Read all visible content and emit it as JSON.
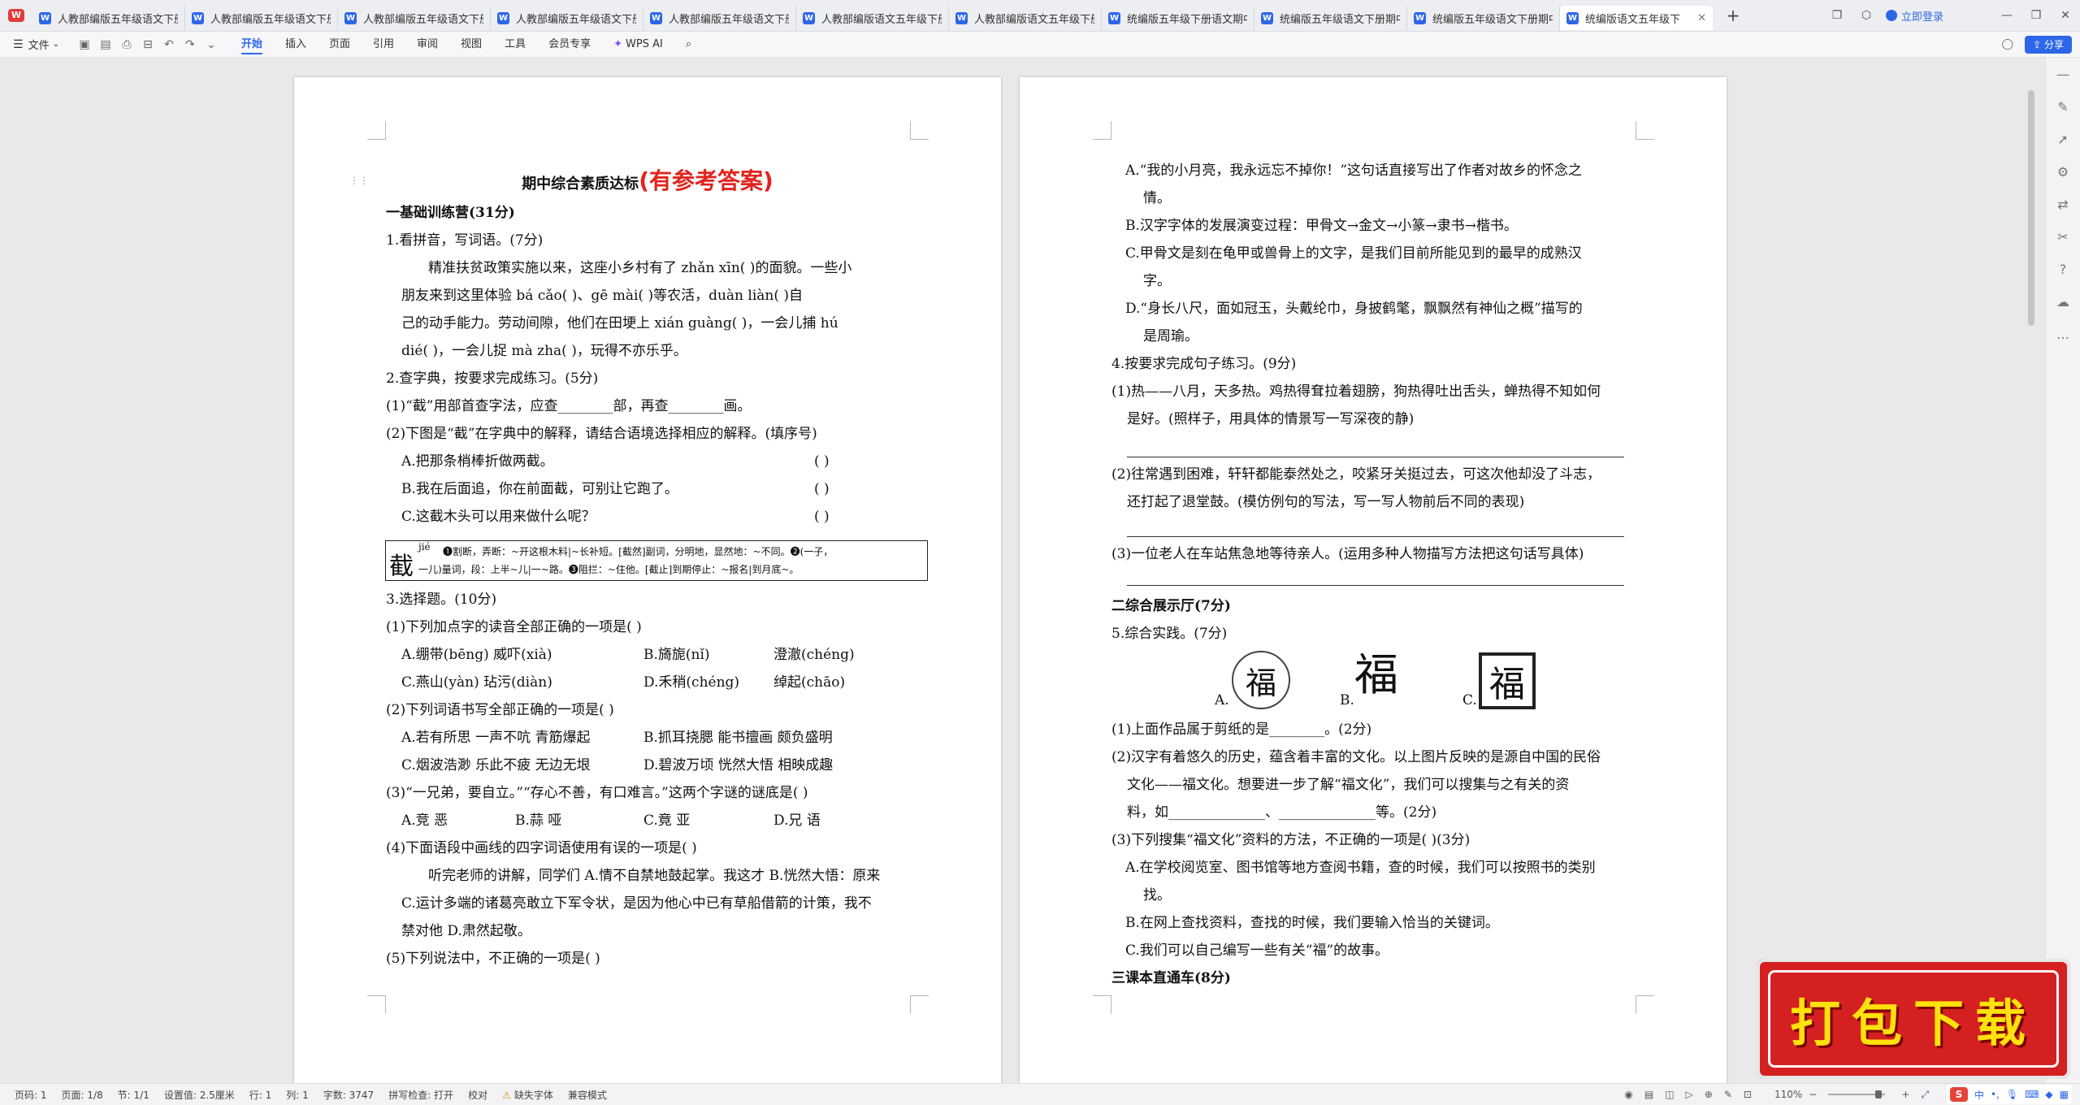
{
  "tabs": [
    {
      "label": "人教部编版五年级语文下册"
    },
    {
      "label": "人教部编版五年级语文下册"
    },
    {
      "label": "人教部编版五年级语文下册"
    },
    {
      "label": "人教部编版五年级语文下册"
    },
    {
      "label": "人教部编版五年级语文下册"
    },
    {
      "label": "人教部编版语文五年级下册"
    },
    {
      "label": "人教部编版语文五年级下册"
    },
    {
      "label": "统编版五年级下册语文期中"
    },
    {
      "label": "统编版五年级语文下册期中"
    },
    {
      "label": "统编版五年级语文下册期中"
    },
    {
      "label": "统编版语文五年级下"
    }
  ],
  "topbar": {
    "login": "立即登录"
  },
  "menubar": {
    "file": "文件",
    "items": [
      "开始",
      "插入",
      "页面",
      "引用",
      "审阅",
      "视图",
      "工具",
      "会员专享"
    ],
    "wps_ai": "WPS AI",
    "share": "分享"
  },
  "page1": {
    "title": "期中综合素质达标",
    "title_red": "(有参考答案)",
    "lines": [
      "一基础训练营(31分)",
      "1.看拼音，写词语。(7分)",
      "精准扶贫政策实施以来，这座小乡村有了 zhǎn xīn(          )的面貌。一些小",
      "朋友来到这里体验 bá cǎo(          )、gē mài(          )等农活，duàn liàn(          )自",
      "己的动手能力。劳动间隙，他们在田埂上 xián guàng(          )，一会儿捕 hú",
      "dié(          )，一会儿捉 mà zha(          )，玩得不亦乐乎。",
      "2.查字典，按要求完成练习。(5分)",
      "(1)“截”用部首查字法，应查________部，再查________画。",
      "(2)下图是“截”在字典中的解释，请结合语境选择相应的解释。(填序号)",
      "A.把那条梢棒折做两截。",
      "B.我在后面追，你在前面截，可别让它跑了。",
      "C.这截木头可以用来做什么呢？",
      "3.选择题。(10分)",
      "(1)下列加点字的读音全部正确的一项是(        )",
      "A.绷带(bēng)        威吓(xià)",
      "B.旖旎(nǐ)",
      "澄澈(chéng)",
      "C.燕山(yàn)        玷污(diàn)",
      "D.禾稍(chéng)",
      "绰起(chāo)",
      "(2)下列词语书写全部正确的一项是(        )",
      "A.若有所思   一声不吭   青筋爆起",
      "B.抓耳挠腮   能书擅画   颇负盛明",
      "C.烟波浩渺   乐此不疲   无边无垠",
      "D.碧波万顷   恍然大悟   相映成趣",
      "(3)“一兄弟，要自立。”“存心不善，有口难言。”这两个字谜的谜底是(        )",
      "A.竞    恶",
      "B.蒜    哑",
      "C.竟    亚",
      "D.兄    语",
      "(4)下面语段中画线的四字词语使用有误的一项是(        )",
      "听完老师的讲解，同学们 A.情不自禁地鼓起掌。我这才 B.恍然大悟：原来",
      "C.运计多端的诸葛亮敢立下军令状，是因为他心中已有草船借箭的计策，我不",
      "禁对他 D.肃然起敬。",
      "(5)下列说法中，不正确的一项是(        )"
    ],
    "choice_brackets": "(        )",
    "dict": {
      "char": "截",
      "pinyin": "jié",
      "line1": "❶割断，弄断：~开这根木料|~长补短。[截然]副词，分明地，显然地：~不同。❷(一子，",
      "line2": "一儿)量词，段：上半~儿|一~路。❸阻拦：~住他。[截止]到期停止：~报名|到月底~。"
    }
  },
  "page2": {
    "lines": [
      "A.“我的小月亮，我永远忘不掉你！”这句话直接写出了作者对故乡的怀念之",
      "情。",
      "B.汉字字体的发展演变过程：甲骨文→金文→小篆→隶书→楷书。",
      "C.甲骨文是刻在龟甲或兽骨上的文字，是我们目前所能见到的最早的成熟汉",
      "字。",
      "D.“身长八尺，面如冠玉，头戴纶巾，身披鹤氅，飘飘然有神仙之概”描写的",
      "是周瑜。",
      "4.按要求完成句子练习。(9分)",
      "(1)热——八月，天多热。鸡热得耷拉着翅膀，狗热得吐出舌头，蝉热得不知如何",
      "是好。(照样子，用具体的情景写一写深夜的静)",
      "(2)往常遇到困难，轩轩都能泰然处之，咬紧牙关挺过去，可这次他却没了斗志，",
      "还打起了退堂鼓。(模仿例句的写法，写一写人物前后不同的表现)",
      "(3)一位老人在车站焦急地等待亲人。(运用多种人物描写方法把这句话写具体)",
      "二综合展示厅(7分)",
      "5.综合实践。(7分)",
      "A.",
      "B.",
      "C.",
      "(1)上面作品属于剪纸的是________。(2分)",
      "(2)汉字有着悠久的历史，蕴含着丰富的文化。以上图片反映的是源自中国的民俗",
      "文化——福文化。想要进一步了解“福文化”，我们可以搜集与之有关的资",
      "料，如______________、______________等。(2分)",
      "(3)下列搜集“福文化”资料的方法，不正确的一项是(        )(3分)",
      "A.在学校阅览室、图书馆等地方查阅书籍，查的时候，我们可以按照书的类别",
      "找。",
      "B.在网上查找资料，查找的时候，我们要输入恰当的关键词。",
      "C.我们可以自己编写一些有关“福”的故事。",
      "三课本直通车(8分)"
    ],
    "fu": "福"
  },
  "status": {
    "page": "页码: 1",
    "pages": "页面: 1/8",
    "section": "节: 1/1",
    "setting": "设置值: 2.5厘米",
    "row": "行: 1",
    "col": "列: 1",
    "words": "字数: 3747",
    "spell": "拼写检查: 打开",
    "proof": "校对",
    "font_missing": "缺失字体",
    "compat": "兼容模式",
    "zoom": "110%"
  },
  "promo": {
    "text": "打包下载"
  },
  "tray": {
    "lang": "中",
    "s": "S"
  }
}
